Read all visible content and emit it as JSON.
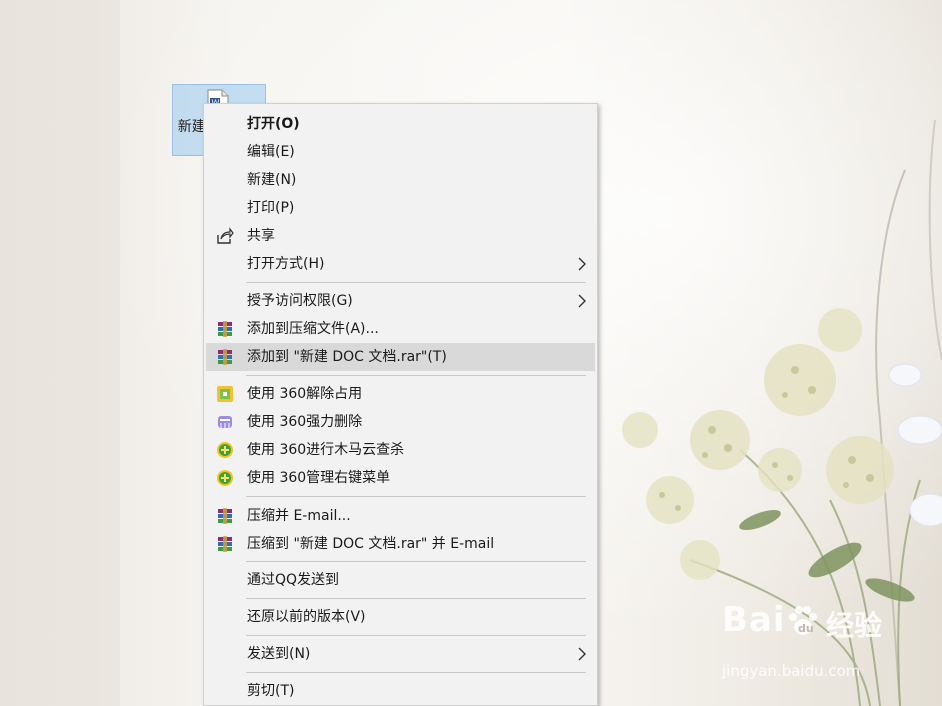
{
  "desktop": {
    "icon_label": "新建 DOC 文档"
  },
  "menu": {
    "open": "打开(O)",
    "edit": "编辑(E)",
    "new": "新建(N)",
    "print": "打印(P)",
    "share": "共享",
    "open_with": "打开方式(H)",
    "grant_access": "授予访问权限(G)",
    "add_archive": "添加到压缩文件(A)...",
    "add_to_rar": "添加到 \"新建 DOC 文档.rar\"(T)",
    "unlock_360": "使用 360解除占用",
    "force_delete_360": "使用 360强力删除",
    "scan_360": "使用 360进行木马云查杀",
    "manage_menu_360": "使用 360管理右键菜单",
    "compress_email": "压缩并 E-mail...",
    "compress_rar_email": "压缩到 \"新建 DOC 文档.rar\" 并 E-mail",
    "send_qq": "通过QQ发送到",
    "restore_versions": "还原以前的版本(V)",
    "send_to": "发送到(N)",
    "cut": "剪切(T)"
  },
  "watermark": {
    "brand": "Bai",
    "sub": "经验",
    "url": "jingyan.baidu.com"
  },
  "colors": {
    "menu_bg": "#f2f2f2",
    "highlight": "#d9d9d9",
    "annotation_arrow": "#e8413a",
    "selection": "#99c9ef"
  }
}
